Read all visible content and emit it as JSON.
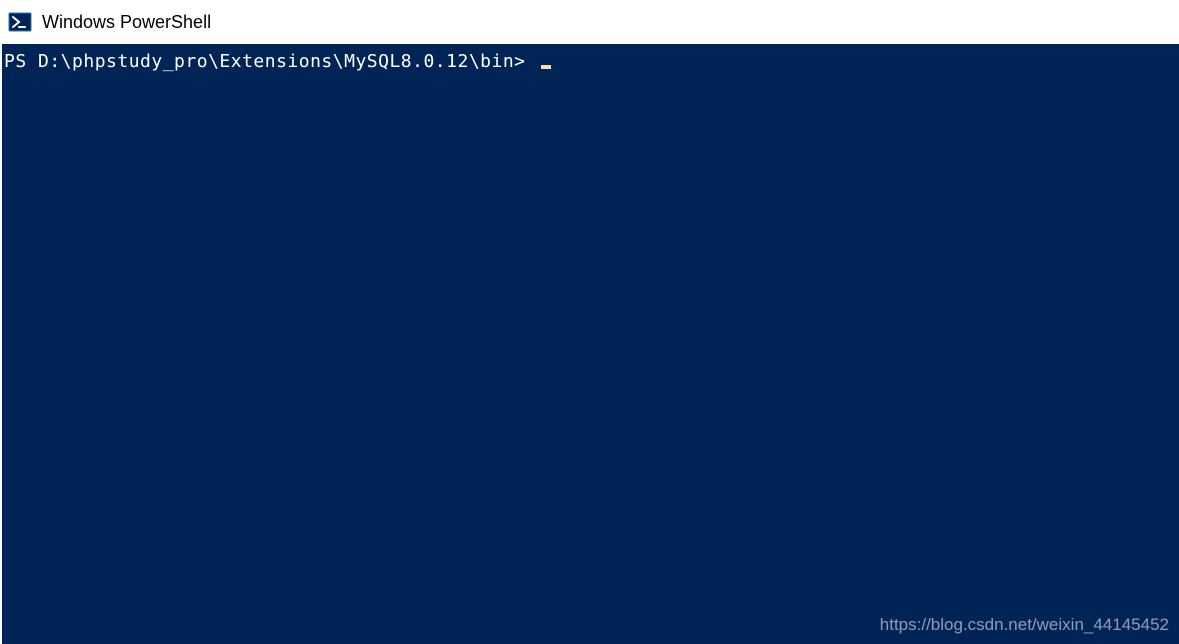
{
  "window": {
    "title": "Windows PowerShell"
  },
  "terminal": {
    "prompt": "PS D:\\phpstudy_pro\\Extensions\\MySQL8.0.12\\bin> "
  },
  "watermark": {
    "text": "https://blog.csdn.net/weixin_44145452"
  },
  "colors": {
    "terminal_bg": "#012456",
    "terminal_fg": "#ffffff",
    "cursor": "#fedba9",
    "titlebar_bg": "#ffffff",
    "titlebar_fg": "#000000"
  }
}
